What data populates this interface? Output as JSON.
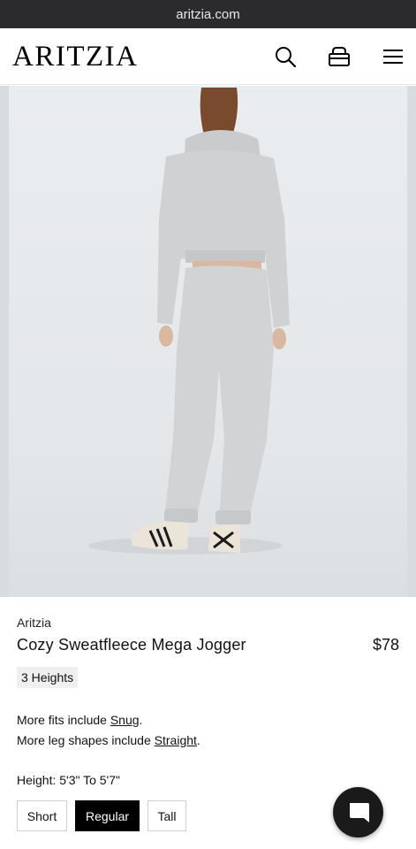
{
  "browser": {
    "url": "aritzia.com"
  },
  "header": {
    "logo": "ARITZIA",
    "icons": [
      "search-icon",
      "bag-icon",
      "menu-icon"
    ]
  },
  "hero": {
    "image": "model in light grey cropped hoodie and jogger, back view"
  },
  "product": {
    "brand": "Aritzia",
    "title": "Cozy Sweatfleece Mega Jogger",
    "price": "$78",
    "badge": "3 Heights"
  },
  "fits": {
    "line1_prefix": "More fits include ",
    "line1_link": "Snug",
    "line1_suffix": ".",
    "line2_prefix": "More leg shapes include ",
    "line2_link": "Straight",
    "line2_suffix": "."
  },
  "height": {
    "label": "Height: 5'3\" To 5'7\"",
    "options": [
      "Short",
      "Regular",
      "Tall"
    ],
    "selected": "Regular"
  },
  "chat": {
    "icon": "chat-icon"
  },
  "colors": {
    "urlbar": "#2b2b2d",
    "selected": "#000000",
    "badge_bg": "#efefef"
  }
}
